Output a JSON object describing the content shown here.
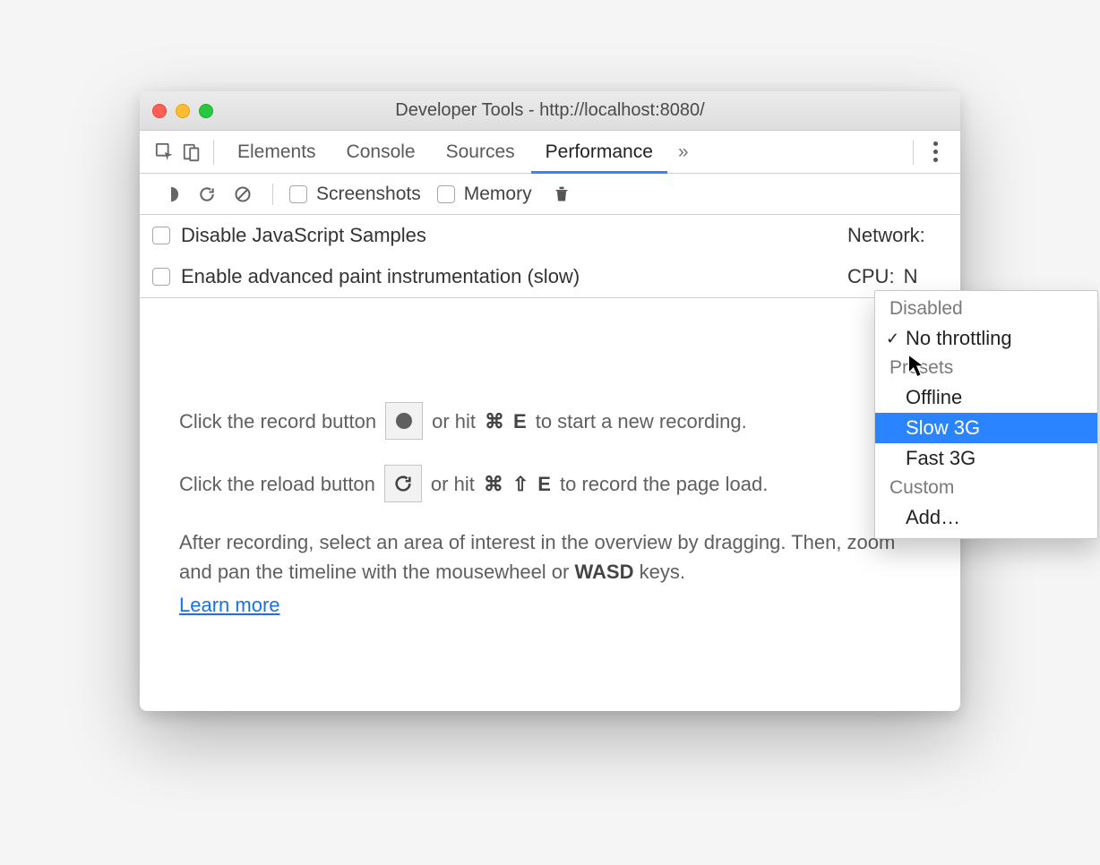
{
  "window": {
    "title": "Developer Tools - http://localhost:8080/"
  },
  "tabs": {
    "elements": "Elements",
    "console": "Console",
    "sources": "Sources",
    "performance": "Performance",
    "more": "»"
  },
  "subbar": {
    "screenshots": "Screenshots",
    "memory": "Memory"
  },
  "options": {
    "disable_js": "Disable JavaScript Samples",
    "enable_paint": "Enable advanced paint instrumentation (slow)",
    "network_label": "Network:",
    "cpu_label": "CPU:",
    "cpu_value_partial": "N"
  },
  "content": {
    "line1a": "Click the record button",
    "line1b": "or hit",
    "shortcut1a": "⌘",
    "shortcut1b": "E",
    "line1c": "to start a new recording.",
    "line2a": "Click the reload button",
    "line2b": "or hit",
    "shortcut2a": "⌘",
    "shortcut2b": "⇧",
    "shortcut2c": "E",
    "line2c": "to record the page load.",
    "line3": "After recording, select an area of interest in the overview by dragging. Then, zoom and pan the timeline with the mousewheel or ",
    "wasd": "WASD",
    "line3b": " keys.",
    "learn_more": "Learn more"
  },
  "dropdown": {
    "sections": {
      "disabled": "Disabled",
      "presets": "Presets",
      "custom": "Custom"
    },
    "items": {
      "no_throttling": "No throttling",
      "offline": "Offline",
      "slow_3g": "Slow 3G",
      "fast_3g": "Fast 3G",
      "add": "Add…"
    }
  }
}
